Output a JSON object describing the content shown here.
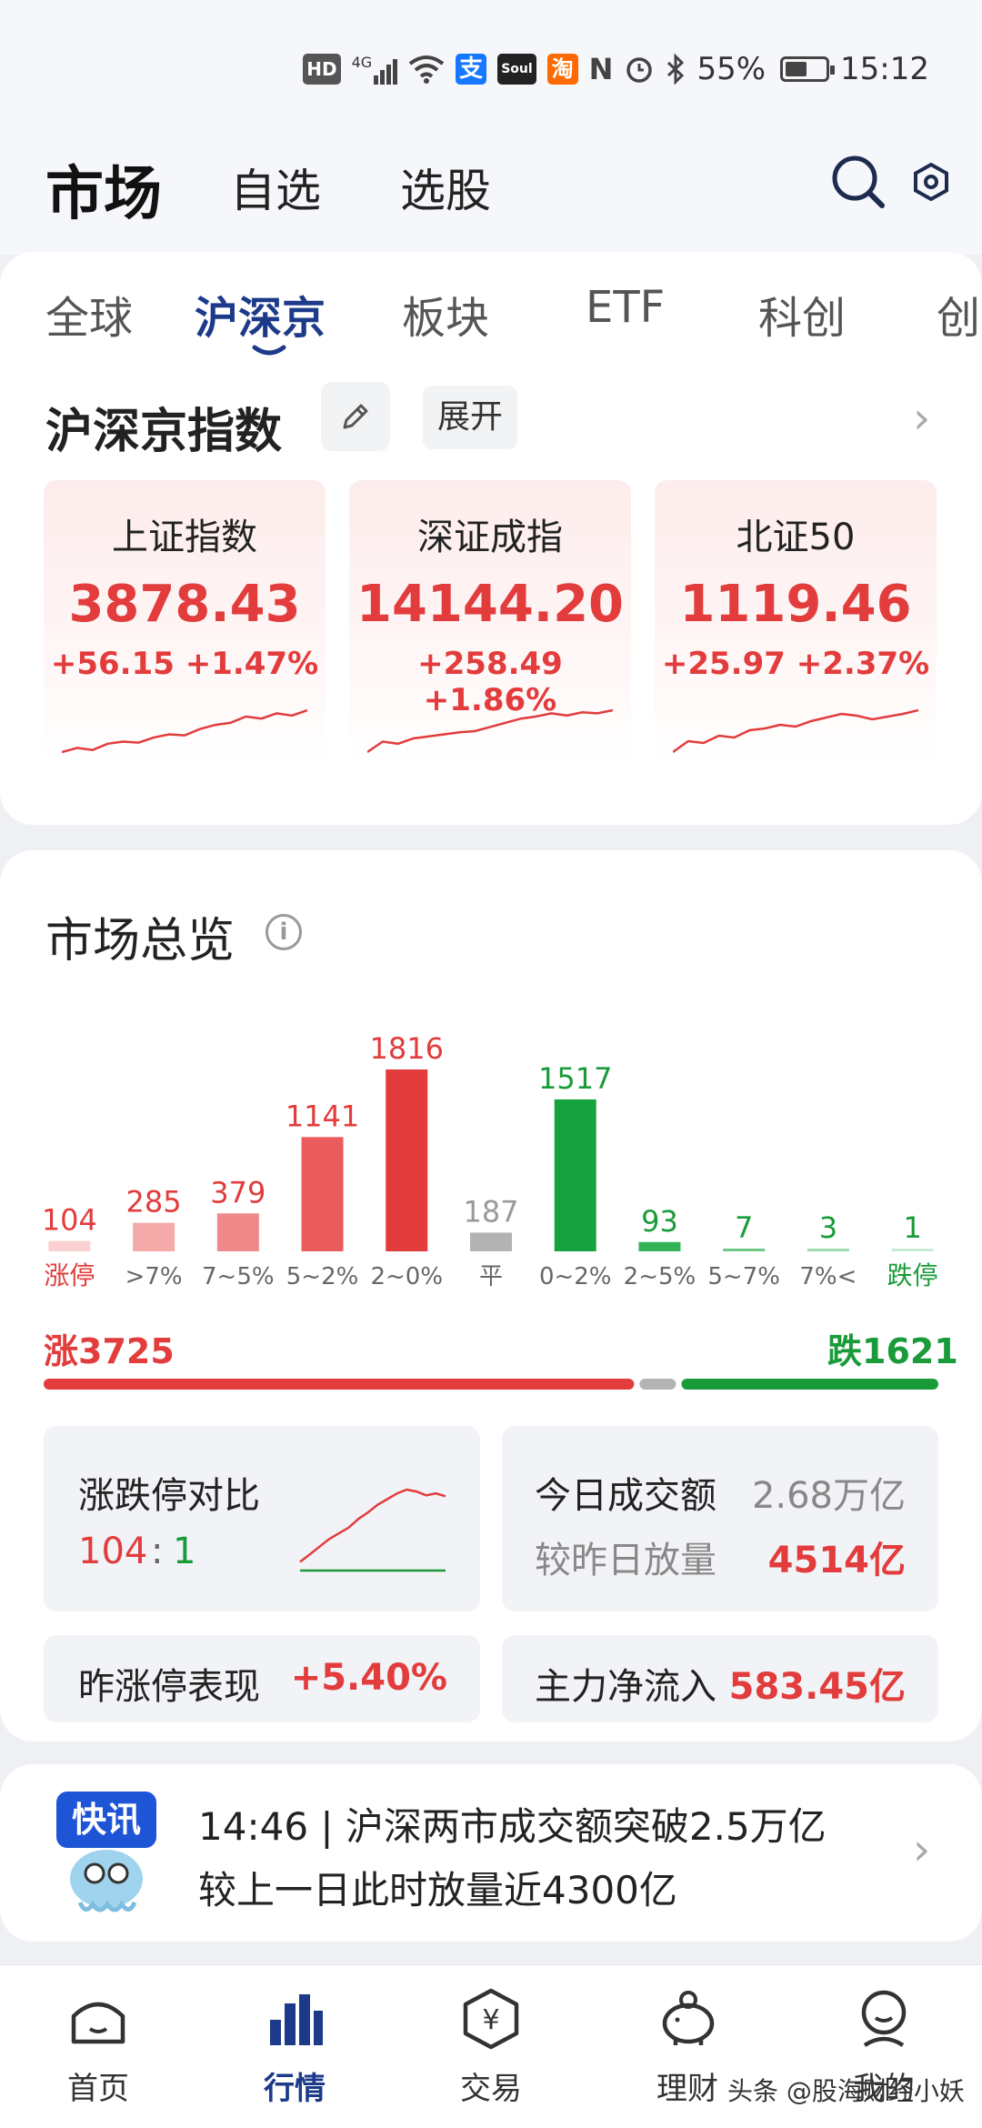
{
  "status_bar": {
    "hd": "HD",
    "network": "4G",
    "alipay": "支",
    "soul": "Soul",
    "taobao": "淘",
    "nfc": "N",
    "battery": "55%",
    "battery_level": 0.55,
    "time": "15:12"
  },
  "header": {
    "tabs": [
      "市场",
      "自选",
      "选股"
    ],
    "active_tab": "市场"
  },
  "subtabs": {
    "items": [
      "全球",
      "沪深京",
      "板块",
      "ETF",
      "科创",
      "创"
    ],
    "active": "沪深京"
  },
  "indices_section": {
    "title": "沪深京指数",
    "expand_label": "展开",
    "indices": [
      {
        "name": "上证指数",
        "value": "3878.43",
        "change": "+56.15  +1.47%",
        "trend": [
          18,
          22,
          20,
          26,
          28,
          27,
          32,
          35,
          34,
          40,
          44,
          46,
          52,
          50,
          55,
          53,
          58
        ]
      },
      {
        "name": "深证成指",
        "value": "14144.20",
        "change": "+258.49  +1.86%",
        "trend": [
          14,
          24,
          22,
          27,
          29,
          31,
          33,
          34,
          38,
          42,
          46,
          48,
          51,
          49,
          52,
          51,
          54
        ]
      },
      {
        "name": "北证50",
        "value": "1119.46",
        "change": "+25.97  +2.37%",
        "trend": [
          10,
          22,
          20,
          28,
          26,
          34,
          36,
          40,
          38,
          44,
          48,
          52,
          50,
          46,
          49,
          52,
          56
        ]
      }
    ]
  },
  "overview": {
    "title": "市场总览",
    "info_icon": "i",
    "up_total": "涨3725",
    "down_total": "跌1621",
    "up_count": 3725,
    "down_count": 1621,
    "limit_compare": {
      "label": "涨跌停对比",
      "up": "104",
      "sep": ":",
      "down": "1"
    },
    "turnover": {
      "label": "今日成交额",
      "value": "2.68万亿"
    },
    "vs_yesterday": {
      "label": "较昨日放量",
      "value": "4514亿"
    },
    "prev_limit_perf": {
      "label": "昨涨停表现",
      "value": "+5.40%"
    },
    "main_inflow": {
      "label": "主力净流入",
      "value": "583.45亿"
    }
  },
  "chart_data": {
    "type": "bar",
    "title": "",
    "xlabel": "",
    "ylabel": "",
    "categories": [
      "涨停",
      ">7%",
      "7~5%",
      "5~2%",
      "2~0%",
      "平",
      "0~2%",
      "2~5%",
      "5~7%",
      "7%<",
      "跌停"
    ],
    "values": [
      104,
      285,
      379,
      1141,
      1816,
      187,
      1517,
      93,
      7,
      3,
      1
    ],
    "colors": [
      "#fbd0d0",
      "#f5a9a9",
      "#f08a8a",
      "#ea5b5b",
      "#e23c3c",
      "#b3b3b3",
      "#16a33f",
      "#34b456",
      "#6cc985",
      "#9fdcae",
      "#c7ebd1"
    ],
    "label_colors": [
      "#e23c3c",
      "#e23c3c",
      "#e23c3c",
      "#e23c3c",
      "#e23c3c",
      "#9a9a9a",
      "#1a9b3a",
      "#1a9b3a",
      "#1a9b3a",
      "#1a9b3a",
      "#1a9b3a"
    ],
    "ylim": [
      0,
      1816
    ]
  },
  "limit_compare_chart": {
    "up_trend": [
      10,
      18,
      26,
      34,
      40,
      46,
      55,
      62,
      70,
      76,
      82,
      86,
      84,
      80,
      82,
      79
    ],
    "down_trend": [
      1,
      1,
      1,
      1,
      1,
      1,
      1,
      1,
      1,
      1,
      1,
      1,
      1,
      1,
      1,
      1
    ]
  },
  "news": {
    "logo_text": "快讯",
    "line1": "14:46 | 沪深两市成交额突破2.5万亿",
    "line2": "较上一日此时放量近4300亿"
  },
  "bottom_nav": {
    "items": [
      "首页",
      "行情",
      "交易",
      "理财",
      "我的"
    ],
    "active": "行情",
    "trade_symbol": "¥"
  },
  "watermark": "头条 @股海财经小妖",
  "colors": {
    "up": "#e23c3c",
    "down": "#1a9b3a",
    "accent": "#1d3a8a",
    "flat": "#b3b3b3"
  }
}
